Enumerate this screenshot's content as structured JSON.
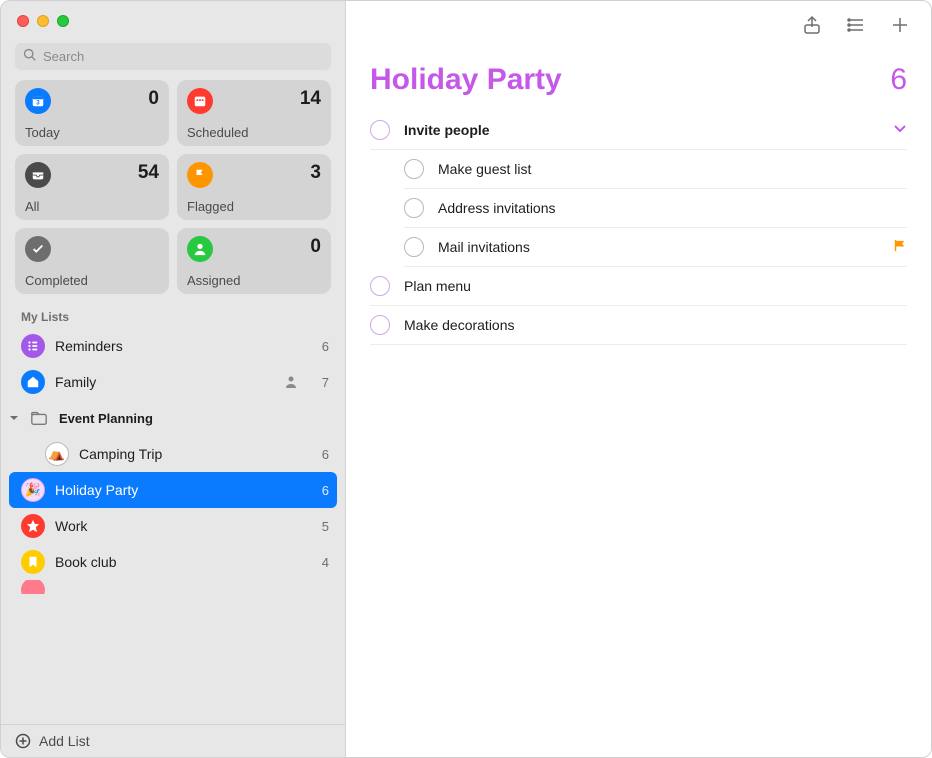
{
  "search": {
    "placeholder": "Search"
  },
  "smart": [
    {
      "key": "today",
      "label": "Today",
      "count": 0,
      "color": "#0a7bff"
    },
    {
      "key": "scheduled",
      "label": "Scheduled",
      "count": 14,
      "color": "#ff3b30"
    },
    {
      "key": "all",
      "label": "All",
      "count": 54,
      "color": "#4a4a4a"
    },
    {
      "key": "flagged",
      "label": "Flagged",
      "count": 3,
      "color": "#ff9500"
    },
    {
      "key": "completed",
      "label": "Completed",
      "count": "",
      "color": "#6e6e6e"
    },
    {
      "key": "assigned",
      "label": "Assigned",
      "count": 0,
      "color": "#28c840"
    }
  ],
  "section_heading": "My Lists",
  "lists": {
    "reminders": {
      "label": "Reminders",
      "count": 6,
      "color": "#a259e8"
    },
    "family": {
      "label": "Family",
      "count": 7,
      "color": "#0a7bff",
      "shared": true
    },
    "group": {
      "label": "Event Planning"
    },
    "camping": {
      "label": "Camping Trip",
      "count": 6,
      "emoji": "⛺"
    },
    "holiday": {
      "label": "Holiday Party",
      "count": 6,
      "emoji": "🎉",
      "selected": true
    },
    "work": {
      "label": "Work",
      "count": 5,
      "color": "#ff3b30"
    },
    "bookclub": {
      "label": "Book club",
      "count": 4,
      "color": "#ffcc00"
    }
  },
  "footer": {
    "add_list": "Add List"
  },
  "main": {
    "title": "Holiday Party",
    "total": 6,
    "accent": "#c558e8",
    "tasks": [
      {
        "title": "Invite people",
        "expandable": true,
        "subtasks": [
          {
            "title": "Make guest list"
          },
          {
            "title": "Address invitations"
          },
          {
            "title": "Mail invitations",
            "flagged": true
          }
        ]
      },
      {
        "title": "Plan menu"
      },
      {
        "title": "Make decorations"
      }
    ]
  }
}
